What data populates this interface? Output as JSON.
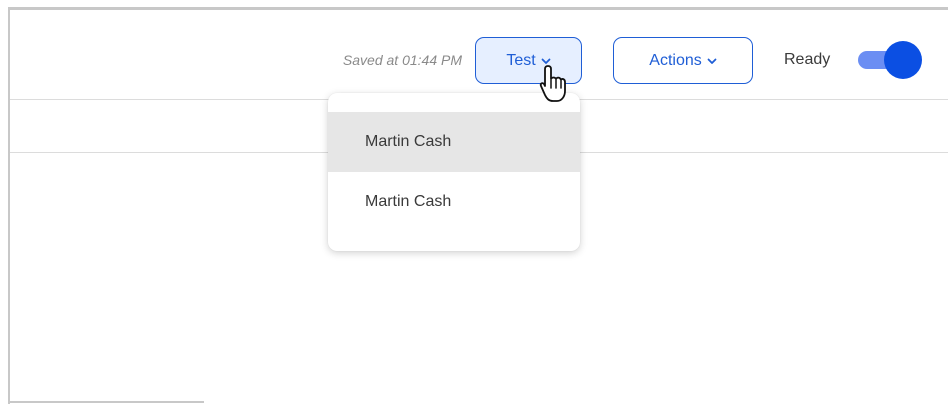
{
  "toolbar": {
    "saved_text": "Saved at 01:44 PM",
    "test_label": "Test",
    "actions_label": "Actions",
    "ready_label": "Ready",
    "ready_enabled": true
  },
  "dropdown": {
    "items": [
      {
        "label": "Martin Cash",
        "hovered": true
      },
      {
        "label": "Martin Cash",
        "hovered": false
      }
    ]
  },
  "icons": {
    "test_chevron": "chevron-down-icon",
    "actions_chevron": "chevron-down-icon",
    "cursor": "hand-pointer-cursor-icon"
  },
  "colors": {
    "primary": "#1f5ed6",
    "test_button_bg": "#e6efff",
    "toggle_track": "#6b8ef3",
    "toggle_knob": "#0b4fe3",
    "hover_bg": "#e6e6e6",
    "muted_text": "#8a8a8a"
  }
}
